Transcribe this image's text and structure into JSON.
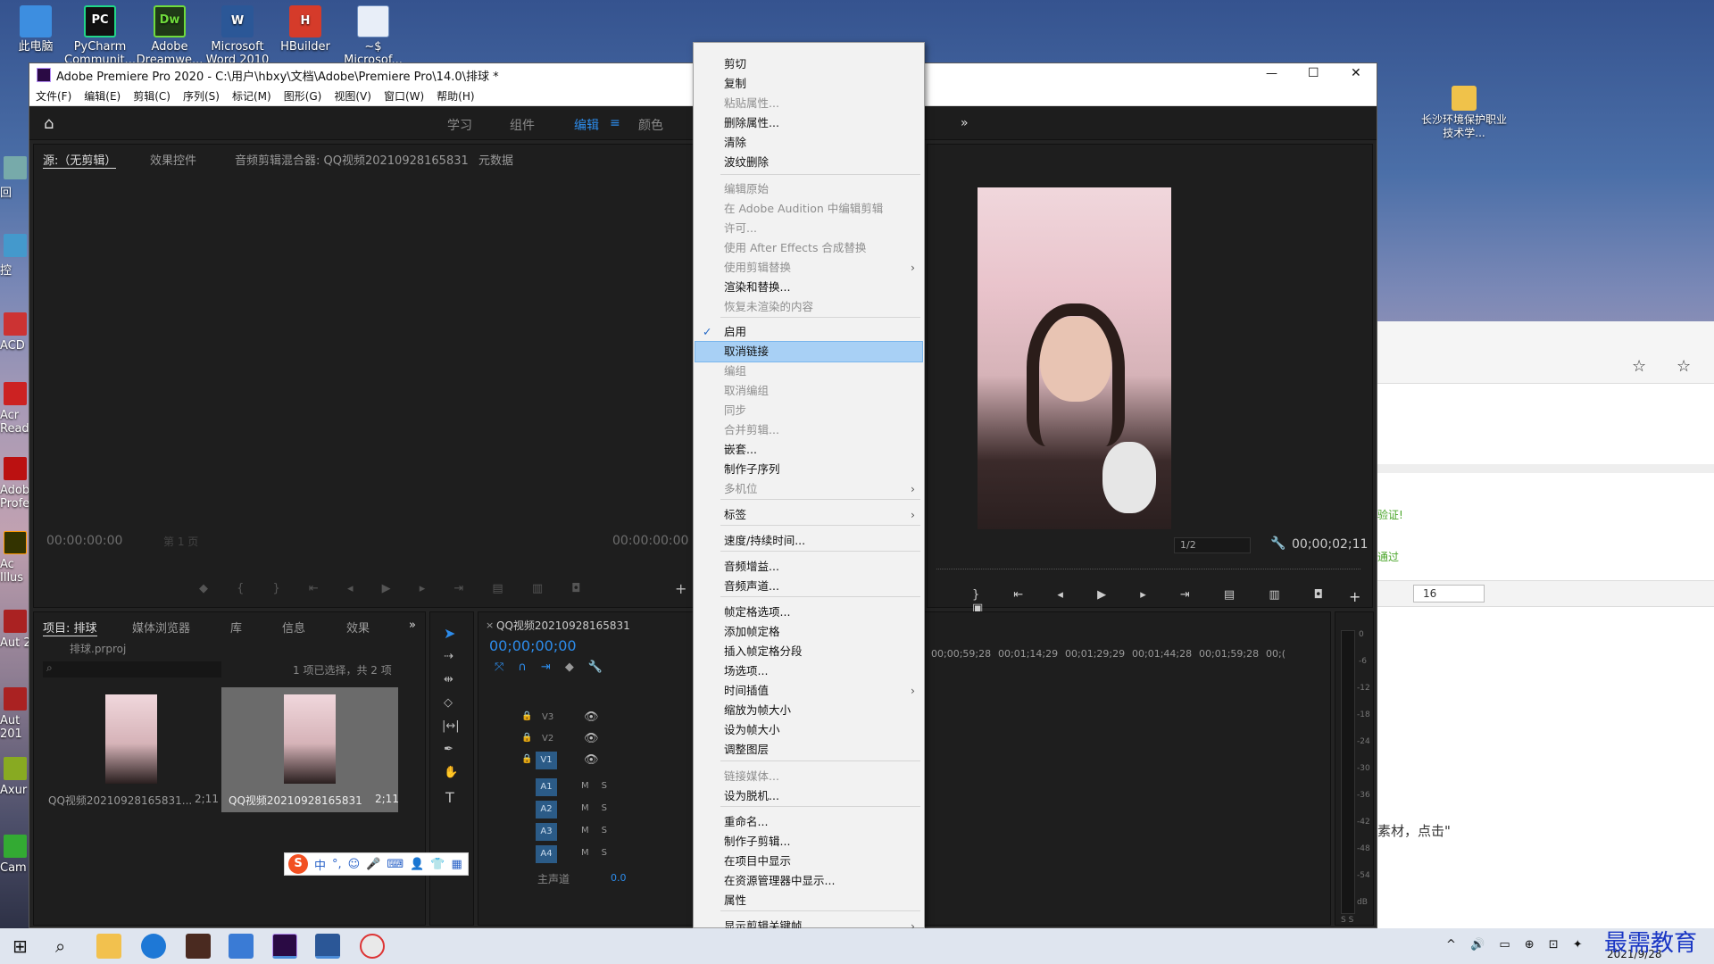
{
  "desktop": {
    "icons": [
      {
        "label": "此电脑",
        "color": "#2a7bd6"
      },
      {
        "label": "PyCharm Communit...",
        "color": "#1a1a1a"
      },
      {
        "label": "Adobe Dreamwe...",
        "color": "#2d4a22"
      },
      {
        "label": "Microsoft Word 2010",
        "color": "#2b5797"
      },
      {
        "label": "HBuilder",
        "color": "#d53b2a"
      },
      {
        "label": "~$ Microsof...",
        "color": "#6f8fbf"
      }
    ],
    "left_icons": [
      "回",
      "控",
      "ACD",
      "Acr Read",
      "Adob Profe",
      "Ac Illus",
      "Aut 2",
      "Aut 201",
      "Axur",
      "Cam"
    ],
    "folder": {
      "label": "长沙环境保护职业技术学..."
    }
  },
  "window": {
    "title": "Adobe Premiere Pro 2020 - C:\\用户\\hbxy\\文档\\Adobe\\Premiere Pro\\14.0\\排球 *",
    "controls": [
      "—",
      "☐",
      "✕"
    ],
    "menu": [
      "文件(F)",
      "编辑(E)",
      "剪辑(C)",
      "序列(S)",
      "标记(M)",
      "图形(G)",
      "视图(V)",
      "窗口(W)",
      "帮助(H)"
    ],
    "workspaces": [
      "学习",
      "组件",
      "编辑",
      "颜色"
    ],
    "more": "»"
  },
  "source_panel": {
    "tabs": [
      "源:（无剪辑）",
      "效果控件",
      "音频剪辑混合器: QQ视频20210928165831",
      "元数据"
    ],
    "tc_left": "00:00:00:00",
    "page": "第 1 页",
    "tc_right": "00:00:00:00"
  },
  "program_panel": {
    "zoom": "1/2",
    "timecode": "00;00;02;11"
  },
  "project_panel": {
    "tabs": [
      "项目: 排球",
      "媒体浏览器",
      "库",
      "信息",
      "效果"
    ],
    "file": "排球.prproj",
    "count": "1 项已选择，共 2 项",
    "items": [
      {
        "name": "QQ视频20210928165831...",
        "dur": "2;11"
      },
      {
        "name": "QQ视频20210928165831",
        "dur": "2;11"
      }
    ]
  },
  "timeline": {
    "tab": "QQ视频20210928165831",
    "timecode": "00;00;00;00",
    "ruler": [
      "00;00;59;28",
      "00;01;14;29",
      "00;01;29;29",
      "00;01;44;28",
      "00;01;59;28",
      "00;("
    ],
    "video_tracks": [
      "V3",
      "V2",
      "V1"
    ],
    "audio_tracks": [
      "A1",
      "A2",
      "A3",
      "A4"
    ],
    "master": "主声道",
    "master_val": "0.0"
  },
  "meter": {
    "labels": [
      "0",
      "-6",
      "-12",
      "-18",
      "-24",
      "-30",
      "-36",
      "-42",
      "-48",
      "-54",
      "dB"
    ],
    "bottom": "S S"
  },
  "context_menu": {
    "items": [
      {
        "label": "剪切",
        "state": "on"
      },
      {
        "label": "复制",
        "state": "on"
      },
      {
        "label": "粘贴属性...",
        "state": "dis"
      },
      {
        "label": "删除属性...",
        "state": "on"
      },
      {
        "label": "清除",
        "state": "on"
      },
      {
        "label": "波纹删除",
        "state": "on"
      },
      {
        "label": "编辑原始",
        "state": "dis"
      },
      {
        "label": "在 Adobe Audition 中编辑剪辑",
        "state": "dis"
      },
      {
        "label": "许可...",
        "state": "dis"
      },
      {
        "label": "使用 After Effects 合成替换",
        "state": "dis"
      },
      {
        "label": "使用剪辑替换",
        "state": "dis"
      },
      {
        "label": "渲染和替换...",
        "state": "on"
      },
      {
        "label": "恢复未渲染的内容",
        "state": "dis"
      },
      {
        "label": "启用",
        "state": "on"
      },
      {
        "label": "取消链接",
        "state": "hl"
      },
      {
        "label": "编组",
        "state": "dis"
      },
      {
        "label": "取消编组",
        "state": "dis"
      },
      {
        "label": "同步",
        "state": "dis"
      },
      {
        "label": "合并剪辑...",
        "state": "dis"
      },
      {
        "label": "嵌套...",
        "state": "on"
      },
      {
        "label": "制作子序列",
        "state": "on"
      },
      {
        "label": "多机位",
        "state": "dis"
      },
      {
        "label": "标签",
        "state": "on"
      },
      {
        "label": "速度/持续时间...",
        "state": "on"
      },
      {
        "label": "音频增益...",
        "state": "on"
      },
      {
        "label": "音频声道...",
        "state": "on"
      },
      {
        "label": "帧定格选项...",
        "state": "on"
      },
      {
        "label": "添加帧定格",
        "state": "on"
      },
      {
        "label": "插入帧定格分段",
        "state": "on"
      },
      {
        "label": "场选项...",
        "state": "on"
      },
      {
        "label": "时间插值",
        "state": "on"
      },
      {
        "label": "缩放为帧大小",
        "state": "on"
      },
      {
        "label": "设为帧大小",
        "state": "on"
      },
      {
        "label": "调整图层",
        "state": "on"
      },
      {
        "label": "链接媒体...",
        "state": "dis"
      },
      {
        "label": "设为脱机...",
        "state": "on"
      },
      {
        "label": "重命名...",
        "state": "on"
      },
      {
        "label": "制作子剪辑...",
        "state": "on"
      },
      {
        "label": "在项目中显示",
        "state": "on"
      },
      {
        "label": "在资源管理器中显示...",
        "state": "on"
      },
      {
        "label": "属性",
        "state": "on"
      },
      {
        "label": "显示剪辑关键帧",
        "state": "on"
      }
    ]
  },
  "right_window": {
    "text1": "验证!",
    "text2": "通过",
    "font_size": "16",
    "text3": "素材，点击\""
  },
  "ime": {
    "items": [
      "中",
      "°,",
      "☺",
      "🎤",
      "⌨",
      "👤",
      "👕",
      "▦"
    ]
  },
  "taskbar": {
    "date": "2021/9/28",
    "watermark": "最需教育"
  }
}
